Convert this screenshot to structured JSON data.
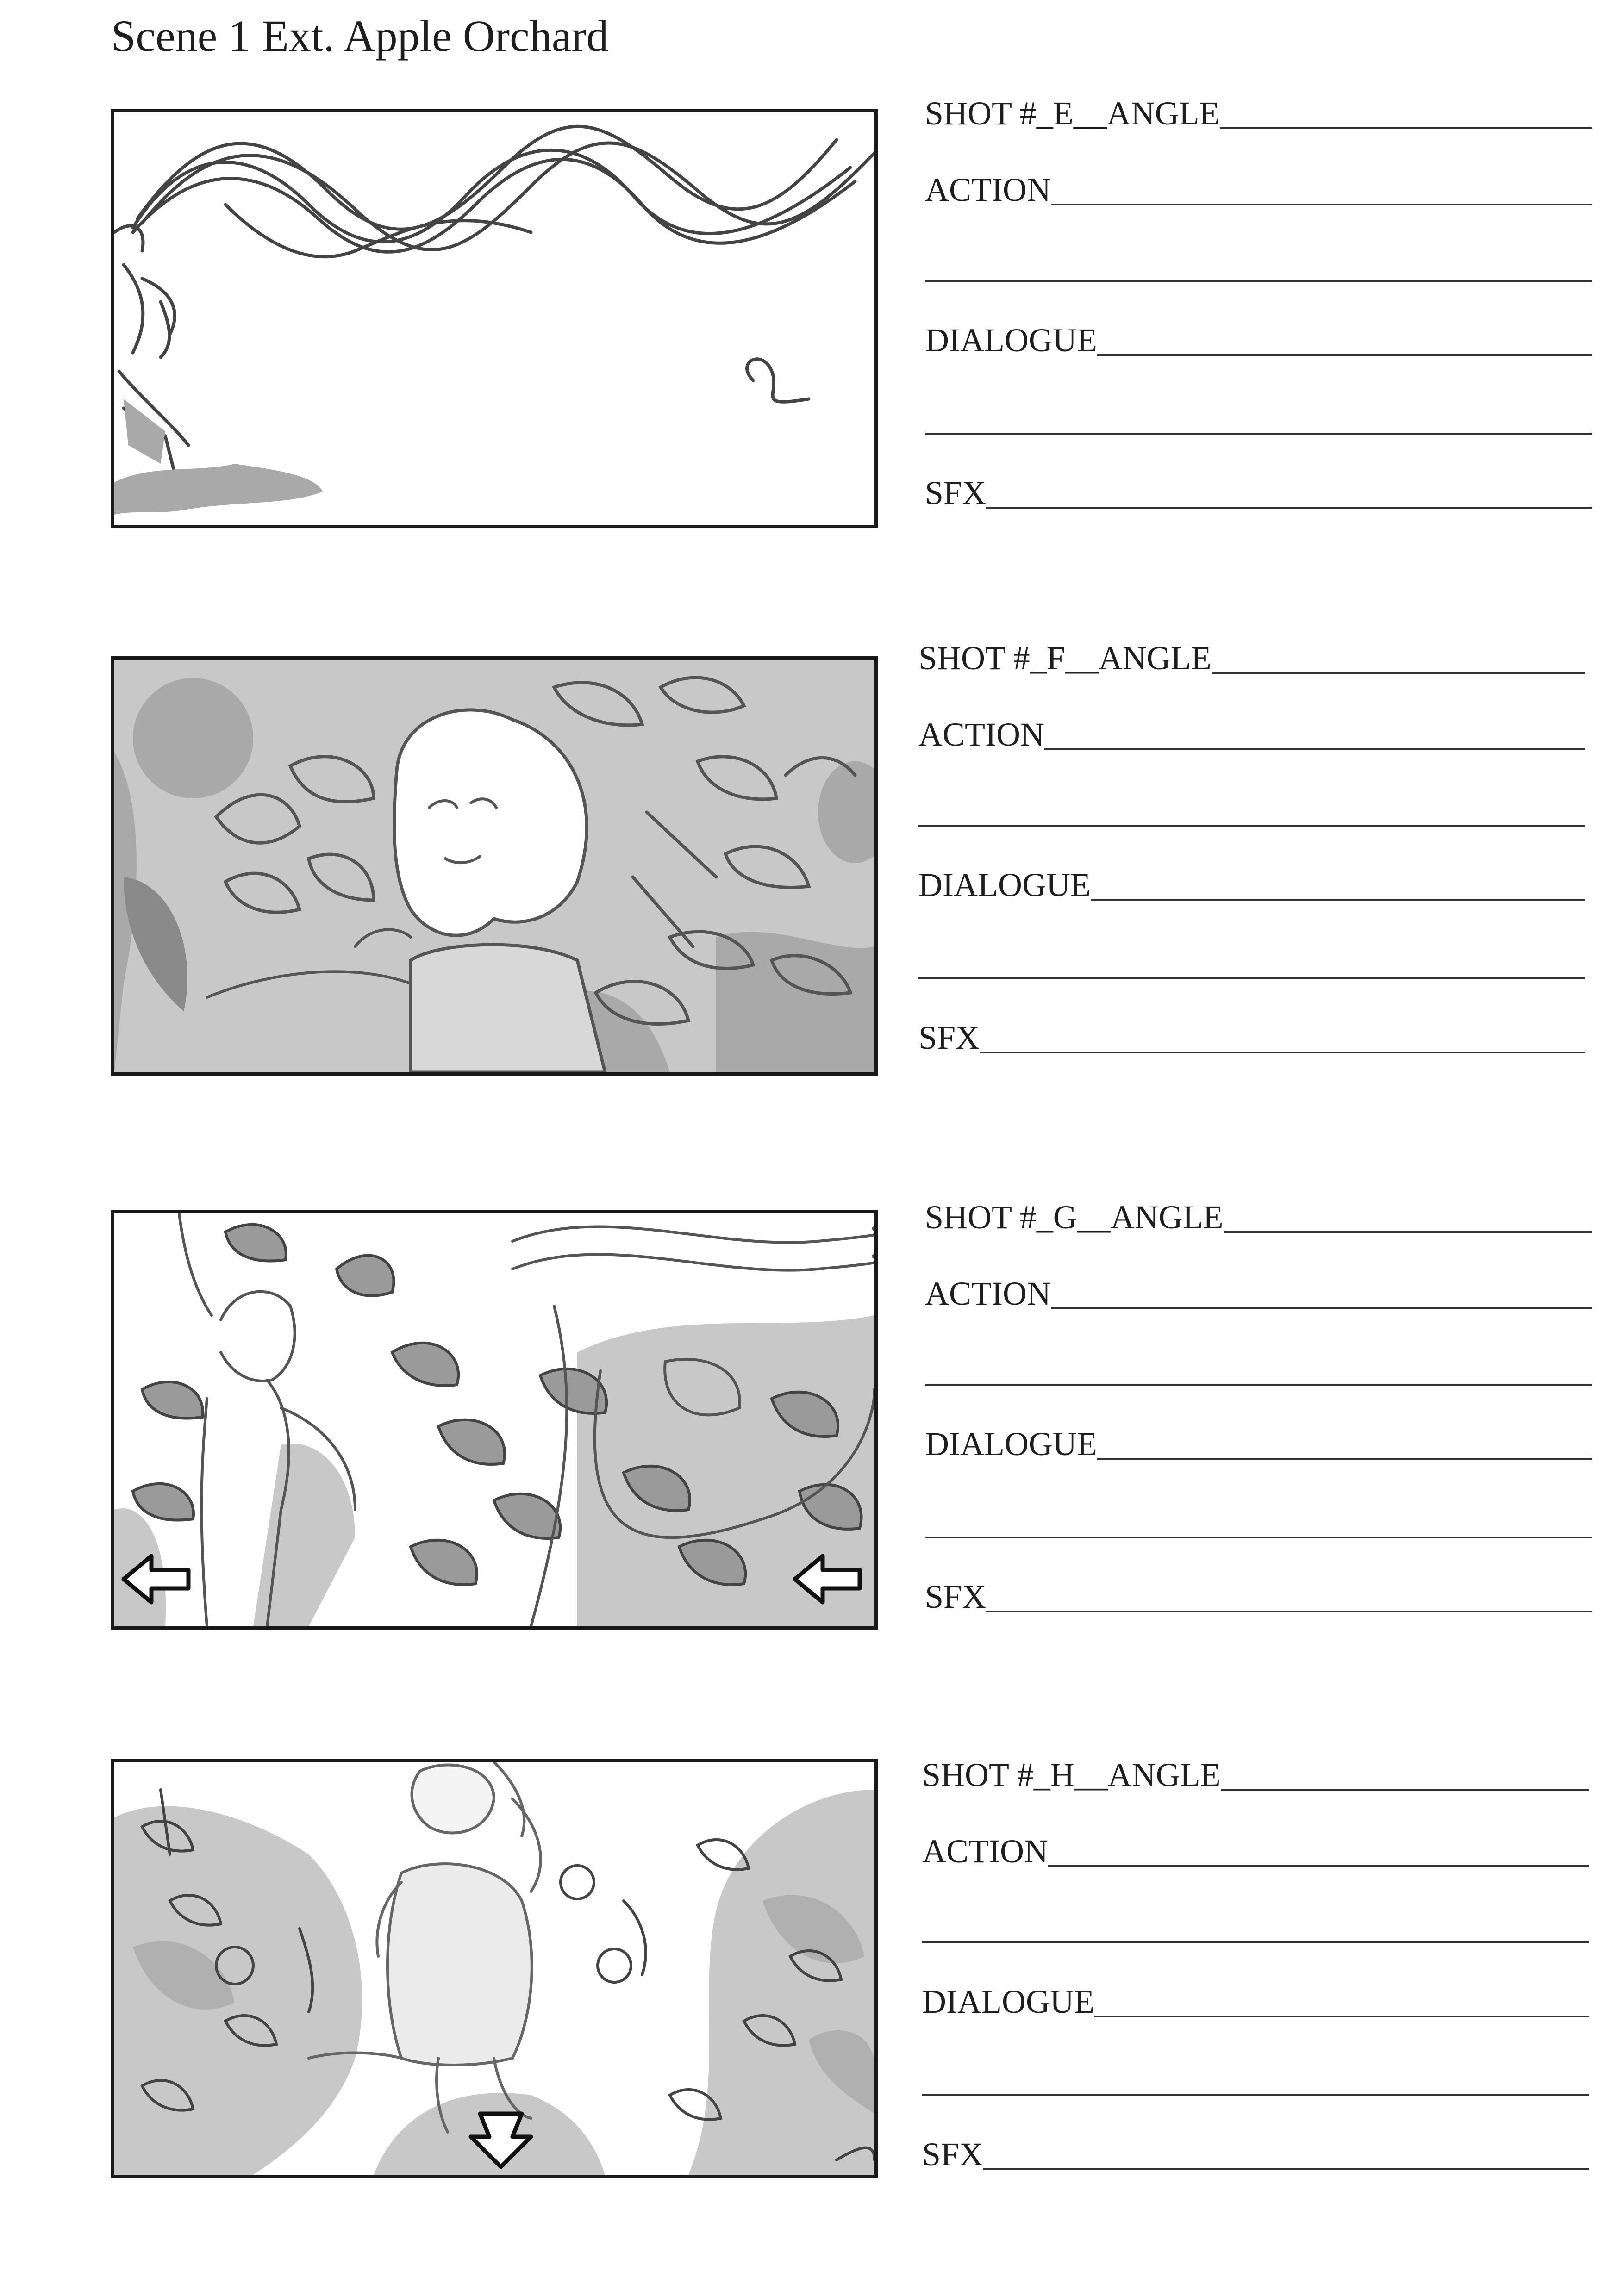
{
  "page": {
    "title": "Scene 1 Ext. Apple Orchard"
  },
  "shots": [
    {
      "shot_label": "SHOT #_E__ANGLE",
      "action_label": "ACTION",
      "dialogue_label": "DIALOGUE",
      "sfx_label": "SFX",
      "sketch": "girl running left with ribbon streamers"
    },
    {
      "shot_label": "SHOT #_F__ANGLE",
      "action_label": "ACTION",
      "dialogue_label": "DIALOGUE",
      "sfx_label": "SFX",
      "sketch": "girl close-up among apple leaves"
    },
    {
      "shot_label": "SHOT #_G__ANGLE",
      "action_label": "ACTION",
      "dialogue_label": "DIALOGUE",
      "sfx_label": "SFX",
      "sketch": "girl in profile among leaves, left arrows"
    },
    {
      "shot_label": "SHOT #_H__ANGLE",
      "action_label": "ACTION",
      "dialogue_label": "DIALOGUE",
      "sfx_label": "SFX",
      "sketch": "girl running toward camera down orchard path, down arrow"
    }
  ],
  "colors": {
    "ink": "#333333",
    "shade_light": "#c8c8c8",
    "shade_mid": "#a9a9a9",
    "shade_dark": "#8a8a8a"
  }
}
